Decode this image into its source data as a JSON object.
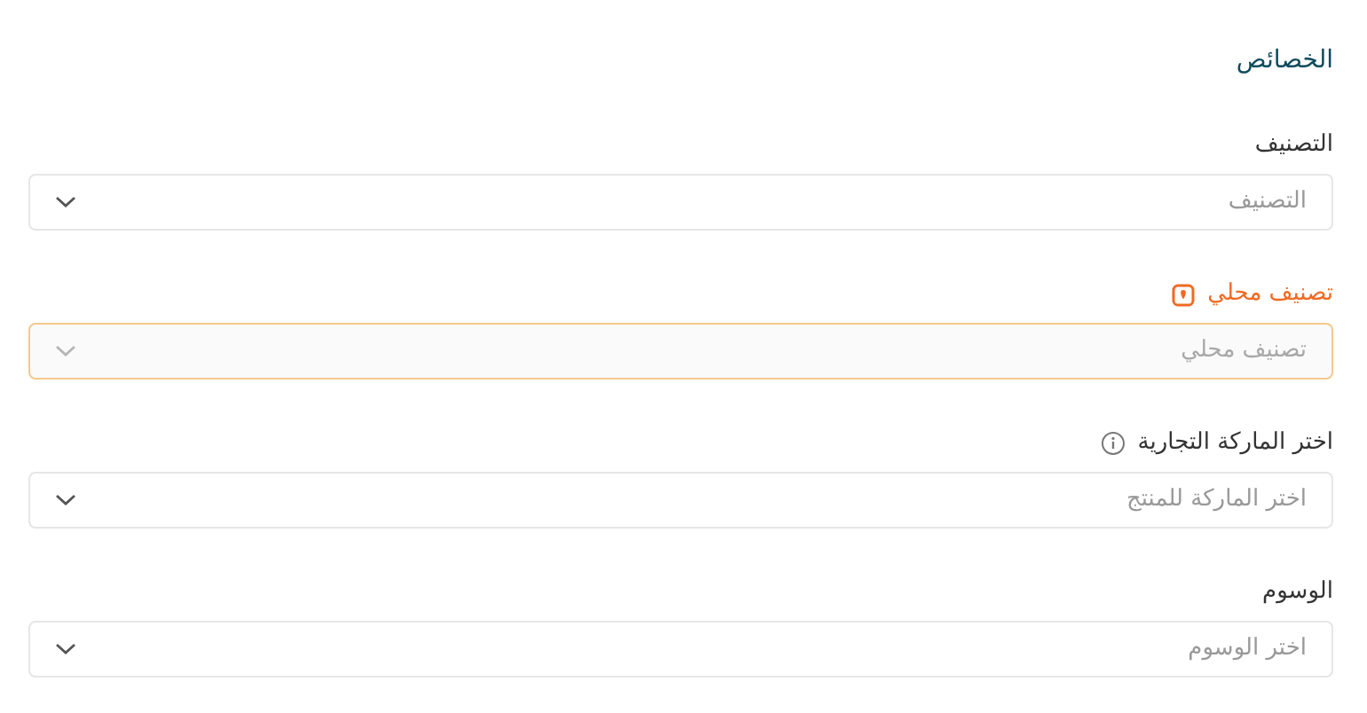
{
  "section_title": "الخصائص",
  "fields": [
    {
      "kind": "plain",
      "label": "التصنيف",
      "placeholder": "التصنيف"
    },
    {
      "kind": "highlighted",
      "label": "تصنيف محلي",
      "placeholder": "تصنيف محلي"
    },
    {
      "kind": "info",
      "label": "اختر الماركة التجارية",
      "placeholder": "اختر الماركة للمنتج"
    },
    {
      "kind": "plain",
      "label": "الوسوم",
      "placeholder": "اختر الوسوم"
    }
  ]
}
